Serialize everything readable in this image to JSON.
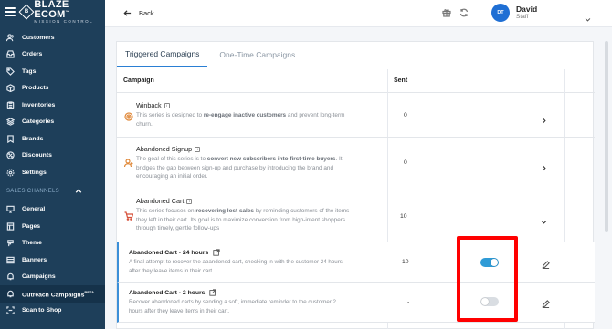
{
  "brand": {
    "title": "BLAZE ECOM",
    "tm": "™",
    "subtitle": "MISSION CONTROL",
    "mark": "B"
  },
  "sidebar": {
    "items": [
      {
        "label": "Customers",
        "icon": "users-icon"
      },
      {
        "label": "Orders",
        "icon": "inbox-icon"
      },
      {
        "label": "Tags",
        "icon": "tag-icon"
      },
      {
        "label": "Products",
        "icon": "box-icon"
      },
      {
        "label": "Inventories",
        "icon": "clipboard-icon"
      },
      {
        "label": "Categories",
        "icon": "layers-icon"
      },
      {
        "label": "Brands",
        "icon": "bookmark-icon"
      },
      {
        "label": "Discounts",
        "icon": "percent-icon"
      },
      {
        "label": "Settings",
        "icon": "gear-icon"
      }
    ],
    "section_title": "SALES CHANNELS",
    "channel_items": [
      {
        "label": "General",
        "icon": "monitor-icon"
      },
      {
        "label": "Pages",
        "icon": "page-icon"
      },
      {
        "label": "Theme",
        "icon": "palette-icon"
      },
      {
        "label": "Banners",
        "icon": "banner-icon"
      },
      {
        "label": "Campaigns",
        "icon": "bell-icon"
      },
      {
        "label": "Outreach Campaigns",
        "beta": "BETA",
        "icon": "outreach-icon",
        "active": true
      },
      {
        "label": "Scan to Shop",
        "icon": "scan-icon"
      }
    ]
  },
  "topbar": {
    "back_label": "Back",
    "user_name": "David",
    "user_role": "Staff",
    "user_initials": "DT"
  },
  "tabs": [
    {
      "label": "Triggered Campaigns",
      "active": true
    },
    {
      "label": "One-Time Campaigns",
      "active": false
    }
  ],
  "table": {
    "headers": {
      "campaign": "Campaign",
      "sent": "Sent"
    },
    "rows": [
      {
        "title": "Winback",
        "desc_pre": "This series is designed to ",
        "desc_bold": "re-engage inactive customers",
        "desc_post": " and prevent long-term churn.",
        "sent": "0"
      },
      {
        "title": "Abandoned Signup",
        "desc_pre": "The goal of this series is to ",
        "desc_bold": "convert new subscribers into first-time buyers",
        "desc_post": ". It bridges the gap between sign-up and purchase by introducing the brand and encouraging an initial order.",
        "sent": "0"
      },
      {
        "title": "Abandoned Cart",
        "desc_pre": "This series focuses on ",
        "desc_bold": "recovering lost sales",
        "desc_post": " by reminding customers of the items they left in their cart. Its goal is to maximize conversion from high-intent shoppers through timely, gentle follow-ups",
        "sent": "10"
      }
    ],
    "sub_rows": [
      {
        "title": "Abandoned Cart - 24 hours",
        "desc": "A final attempt to recover the abandoned cart, checking in with the customer 24 hours after they leave items in their cart.",
        "sent": "10",
        "enabled": true
      },
      {
        "title": "Abandoned Cart - 2 hours",
        "desc": "Recover abandoned carts by sending a soft, immediate reminder to the customer 2 hours after they leave items in their cart.",
        "sent": "-",
        "enabled": false
      }
    ]
  },
  "colors": {
    "sidebar_bg": "#1e3f5a",
    "accent": "#2f9bd6",
    "highlight": "#ff0000",
    "icon_orange": "#e0893a"
  }
}
